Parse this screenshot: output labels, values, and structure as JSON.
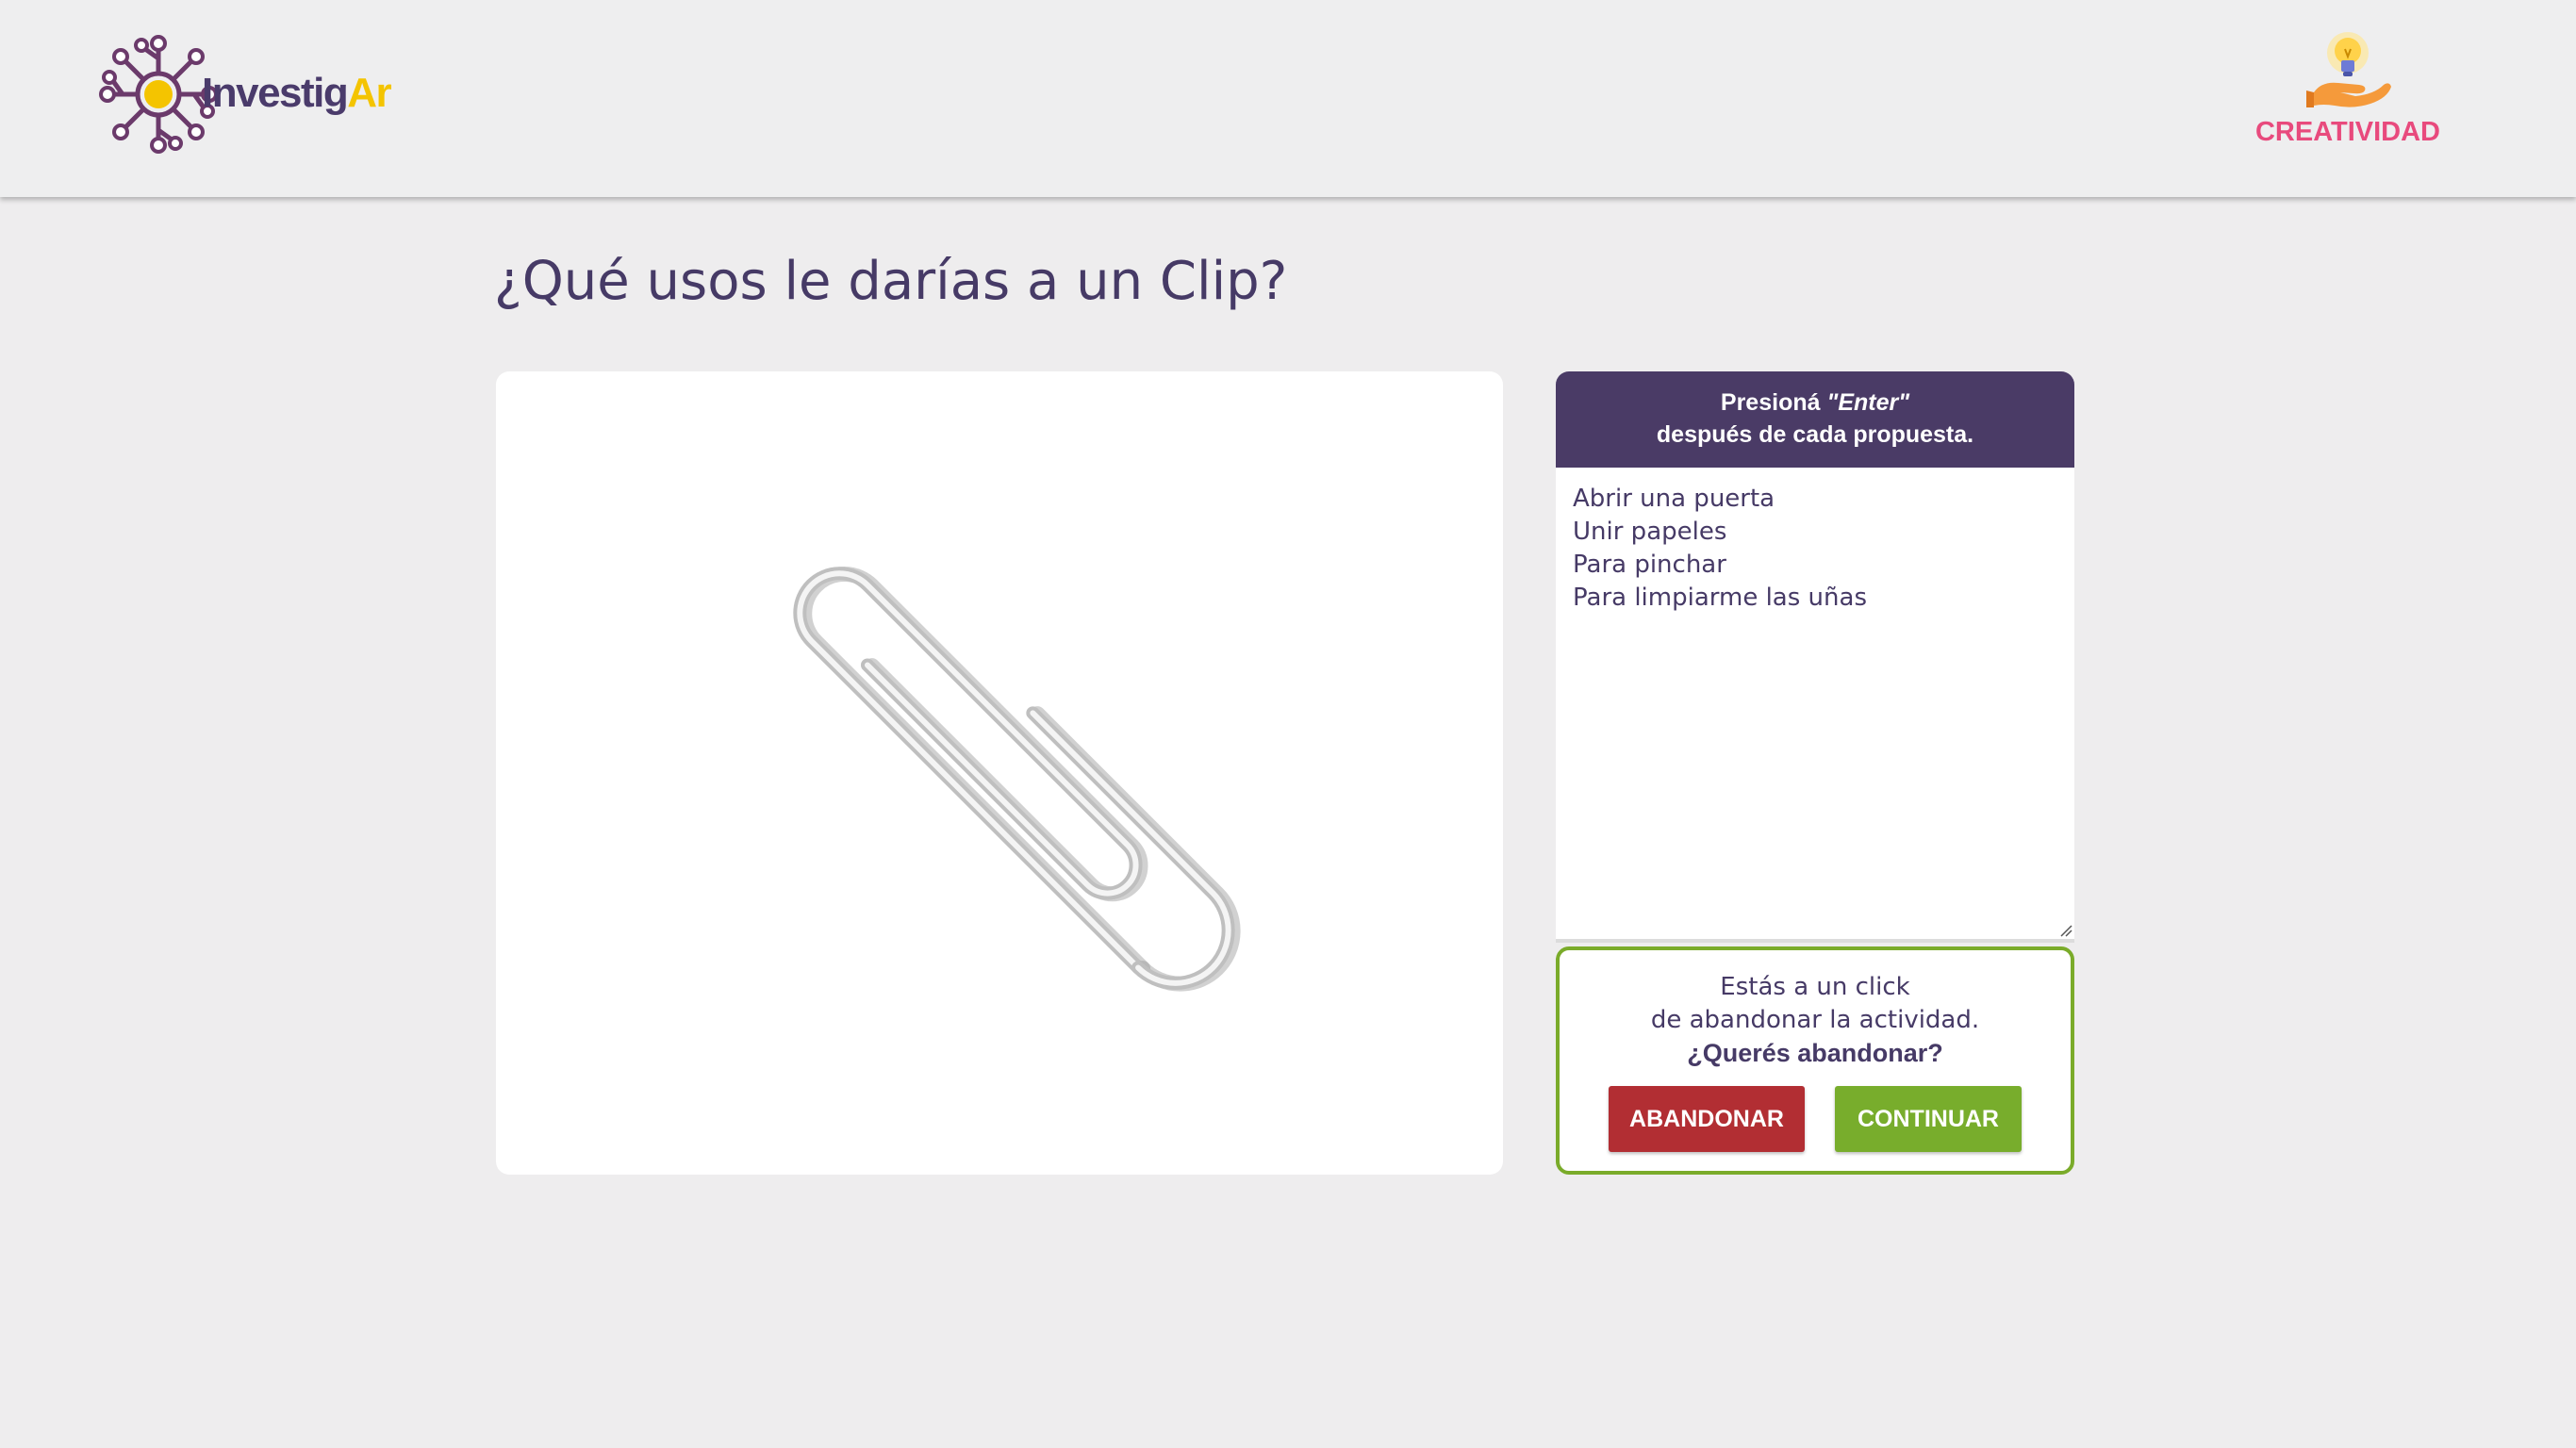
{
  "header": {
    "logo": {
      "text_main": "Investig",
      "text_accent": "Ar",
      "icon": "network-sun-icon"
    },
    "category": {
      "label": "CREATIVIDAD",
      "icon": "lightbulb-hand-icon"
    }
  },
  "main": {
    "title": "¿Qué usos le darías a un Clip?",
    "image": {
      "icon": "paperclip-icon"
    }
  },
  "answers": {
    "instruction_prefix": "Presioná ",
    "instruction_key": "\"Enter\"",
    "instruction_suffix": "después de cada propuesta.",
    "items": [
      "Abrir una puerta",
      "Unir papeles",
      "Para pinchar",
      "Para limpiarme las uñas"
    ]
  },
  "abandon": {
    "line1": "Estás a un click",
    "line2": "de abandonar la actividad.",
    "question": "¿Querés abandonar?",
    "abandon_label": "ABANDONAR",
    "continue_label": "CONTINUAR"
  },
  "colors": {
    "brand_purple": "#4a3b66",
    "brand_yellow": "#f4c400",
    "accent_pink": "#e84a7d",
    "abandon_red": "#b22e33",
    "continue_green": "#78ad2c"
  }
}
